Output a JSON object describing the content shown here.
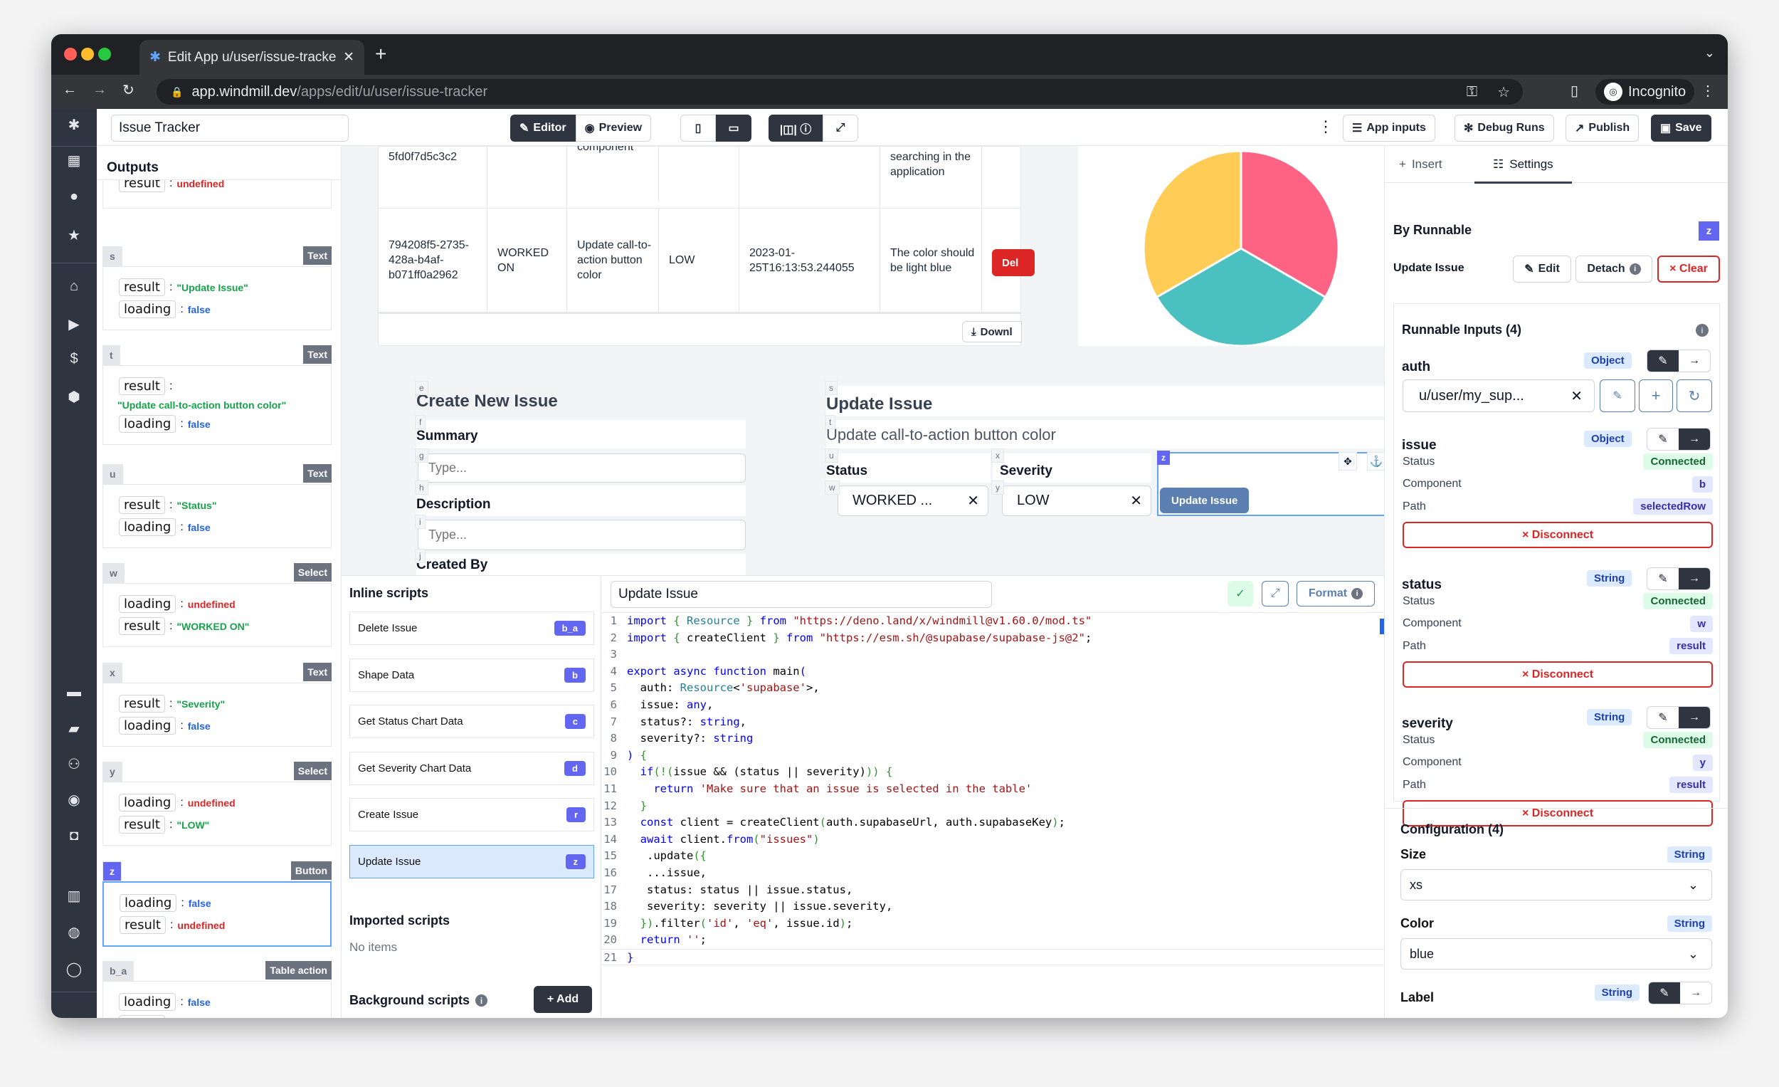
{
  "browser": {
    "tab_title": "Edit App u/user/issue-tracker",
    "url_host": "app.windmill.dev",
    "url_path": "/apps/edit/u/user/issue-tracker",
    "profile": "Incognito"
  },
  "toolbar": {
    "app_name": "Issue Tracker",
    "editor": "Editor",
    "preview": "Preview",
    "app_inputs": "App inputs",
    "debug_runs": "Debug Runs",
    "publish": "Publish",
    "save": "Save"
  },
  "sidebar_icons": [
    "windmill-logo",
    "building",
    "user",
    "star",
    "home",
    "play",
    "dollar",
    "cubes",
    "calendar",
    "folder",
    "users",
    "eye",
    "robot",
    "book",
    "discord",
    "github",
    "arrow-right"
  ],
  "outputs": {
    "title": "Outputs",
    "top_partial": {
      "key": "result",
      "value": "undefined"
    },
    "cards": [
      {
        "id": "s",
        "type": "Text",
        "fields": [
          {
            "key": "result",
            "value": "\"Update Issue\"",
            "kind": "str"
          },
          {
            "key": "loading",
            "value": "false",
            "kind": "false"
          }
        ]
      },
      {
        "id": "t",
        "type": "Text",
        "fields": [
          {
            "key": "result",
            "value": "\"Update call-to-action button color\"",
            "kind": "str",
            "wrap": true
          },
          {
            "key": "loading",
            "value": "false",
            "kind": "false"
          }
        ]
      },
      {
        "id": "u",
        "type": "Text",
        "fields": [
          {
            "key": "result",
            "value": "\"Status\"",
            "kind": "str"
          },
          {
            "key": "loading",
            "value": "false",
            "kind": "false"
          }
        ]
      },
      {
        "id": "w",
        "type": "Select",
        "fields": [
          {
            "key": "loading",
            "value": "undefined",
            "kind": "undef"
          },
          {
            "key": "result",
            "value": "\"WORKED ON\"",
            "kind": "str"
          }
        ]
      },
      {
        "id": "x",
        "type": "Text",
        "fields": [
          {
            "key": "result",
            "value": "\"Severity\"",
            "kind": "str"
          },
          {
            "key": "loading",
            "value": "false",
            "kind": "false"
          }
        ]
      },
      {
        "id": "y",
        "type": "Select",
        "fields": [
          {
            "key": "loading",
            "value": "undefined",
            "kind": "undef"
          },
          {
            "key": "result",
            "value": "\"LOW\"",
            "kind": "str"
          }
        ]
      },
      {
        "id": "z",
        "type": "Button",
        "selected": true,
        "fields": [
          {
            "key": "loading",
            "value": "false",
            "kind": "false"
          },
          {
            "key": "result",
            "value": "undefined",
            "kind": "undef"
          }
        ]
      },
      {
        "id": "b_a",
        "type": "Table action",
        "fields": [
          {
            "key": "loading",
            "value": "false",
            "kind": "false"
          },
          {
            "key": "result",
            "value": "undefined",
            "kind": "undef"
          }
        ]
      }
    ]
  },
  "table": {
    "rows": [
      [
        "5fd0f7d5c3c2",
        "",
        "component",
        "",
        "",
        "searching in the application"
      ],
      [
        "794208f5-2735-428a-b4af-b071ff0a2962",
        "WORKED ON",
        "Update call-to-action button color",
        "LOW",
        "2023-01-25T16:13:53.244055",
        "The color should be light blue"
      ]
    ],
    "delete_label": "Del",
    "download_label": "Downl"
  },
  "pie": {
    "values": [
      1,
      1,
      1
    ],
    "colors": [
      "#ff6384",
      "#4bc0c0",
      "#ffcd56"
    ]
  },
  "create_form": {
    "ids": [
      "e",
      "f",
      "g",
      "h",
      "i",
      "j"
    ],
    "title": "Create New Issue",
    "summary_label": "Summary",
    "summary_placeholder": "Type...",
    "description_label": "Description",
    "description_placeholder": "Type...",
    "created_by_label": "Created By"
  },
  "update_form": {
    "ids": [
      "s",
      "t",
      "u",
      "x",
      "z",
      "w",
      "y"
    ],
    "title": "Update Issue",
    "summary": "Update call-to-action button color",
    "status_label": "Status",
    "severity_label": "Severity",
    "status_value": "WORKED ...",
    "severity_value": "LOW",
    "button_label": "Update Issue"
  },
  "scripts": {
    "inline_title": "Inline scripts",
    "inline": [
      {
        "name": "Delete Issue",
        "id": "b_a"
      },
      {
        "name": "Shape Data",
        "id": "b"
      },
      {
        "name": "Get Status Chart Data",
        "id": "c"
      },
      {
        "name": "Get Severity Chart Data",
        "id": "d"
      },
      {
        "name": "Create Issue",
        "id": "r"
      },
      {
        "name": "Update Issue",
        "id": "z",
        "selected": true
      }
    ],
    "imported_title": "Imported scripts",
    "imported_empty": "No items",
    "background_title": "Background scripts",
    "add_label": "+ Add"
  },
  "editor": {
    "script_name": "Update Issue",
    "format_label": "Format",
    "lines": [
      [
        [
          "kw",
          "import "
        ],
        [
          "br",
          "{ "
        ],
        [
          "type",
          "Resource"
        ],
        [
          "br",
          " } "
        ],
        [
          "kw",
          "from "
        ],
        [
          "str",
          "\"https://deno.land/x/windmill@v1.60.0/mod.ts\""
        ]
      ],
      [
        [
          "kw",
          "import "
        ],
        [
          "br",
          "{ "
        ],
        [
          "plain",
          "createClient"
        ],
        [
          "br",
          " } "
        ],
        [
          "kw",
          "from "
        ],
        [
          "str",
          "\"https://esm.sh/@supabase/supabase-js@2\""
        ],
        [
          "plain",
          ";"
        ]
      ],
      [],
      [
        [
          "kw",
          "export async function "
        ],
        [
          "plain",
          "main"
        ],
        [
          "kw",
          "("
        ]
      ],
      [
        [
          "plain",
          "  auth: "
        ],
        [
          "type",
          "Resource"
        ],
        [
          "plain",
          "<"
        ],
        [
          "str",
          "'supabase'"
        ],
        [
          "plain",
          ">,"
        ]
      ],
      [
        [
          "plain",
          "  issue: "
        ],
        [
          "kw",
          "any"
        ],
        [
          "plain",
          ","
        ]
      ],
      [
        [
          "plain",
          "  status?: "
        ],
        [
          "kw",
          "string"
        ],
        [
          "plain",
          ","
        ]
      ],
      [
        [
          "plain",
          "  severity?: "
        ],
        [
          "kw",
          "string"
        ]
      ],
      [
        [
          "kw",
          ") "
        ],
        [
          "br",
          "{"
        ]
      ],
      [
        [
          "kw",
          "  if"
        ],
        [
          "br",
          "(!("
        ],
        [
          "plain",
          "issue && (status || severity)"
        ],
        [
          "br",
          ")) {"
        ]
      ],
      [
        [
          "kw",
          "    return "
        ],
        [
          "str",
          "'Make sure that an issue is selected in the table'"
        ]
      ],
      [
        [
          "br",
          "  }"
        ]
      ],
      [
        [
          "kw",
          "  const "
        ],
        [
          "plain",
          "client = createClient"
        ],
        [
          "br",
          "("
        ],
        [
          "plain",
          "auth.supabaseUrl, auth.supabaseKey"
        ],
        [
          "br",
          ")"
        ],
        [
          "plain",
          ";"
        ]
      ],
      [
        [
          "kw",
          "  await "
        ],
        [
          "plain",
          "client."
        ],
        [
          "kw",
          "from"
        ],
        [
          "br",
          "("
        ],
        [
          "str",
          "\"issues\""
        ],
        [
          "br",
          ")"
        ]
      ],
      [
        [
          "plain",
          "   .update"
        ],
        [
          "br",
          "({"
        ]
      ],
      [
        [
          "plain",
          "   ...issue,"
        ]
      ],
      [
        [
          "plain",
          "   status: status || issue.status,"
        ]
      ],
      [
        [
          "plain",
          "   severity: severity || issue.severity,"
        ]
      ],
      [
        [
          "br",
          "  })"
        ],
        [
          "plain",
          ".filter"
        ],
        [
          "br",
          "("
        ],
        [
          "str",
          "'id'"
        ],
        [
          "plain",
          ", "
        ],
        [
          "str",
          "'eq'"
        ],
        [
          "plain",
          ", issue.id"
        ],
        [
          "br",
          ")"
        ],
        [
          "plain",
          ";"
        ]
      ],
      [
        [
          "kw",
          "  return "
        ],
        [
          "str",
          "''"
        ],
        [
          "plain",
          ";"
        ]
      ],
      [
        [
          "kw",
          "}"
        ]
      ]
    ]
  },
  "settings": {
    "tab_insert": "Insert",
    "tab_settings": "Settings",
    "by_runnable": "By Runnable",
    "runnable_id": "z",
    "runnable_name": "Update Issue",
    "edit": "Edit",
    "detach": "Detach",
    "clear": "× Clear",
    "inputs_title": "Runnable Inputs (4)",
    "auth": {
      "name": "auth",
      "type": "Object",
      "value": "u/user/my_sup..."
    },
    "status_label": "Status",
    "component_label": "Component",
    "path_label": "Path",
    "disconnect": "× Disconnect",
    "connected": "Connected",
    "issue": {
      "name": "issue",
      "type": "Object",
      "component": "b",
      "path": "selectedRow"
    },
    "status": {
      "name": "status",
      "type": "String",
      "component": "w",
      "path": "result"
    },
    "severity": {
      "name": "severity",
      "type": "String",
      "component": "y",
      "path": "result"
    },
    "config_title": "Configuration (4)",
    "size": {
      "label": "Size",
      "type": "String",
      "value": "xs"
    },
    "color": {
      "label": "Color",
      "type": "String",
      "value": "blue"
    },
    "label": {
      "label": "Label",
      "type": "String"
    }
  }
}
